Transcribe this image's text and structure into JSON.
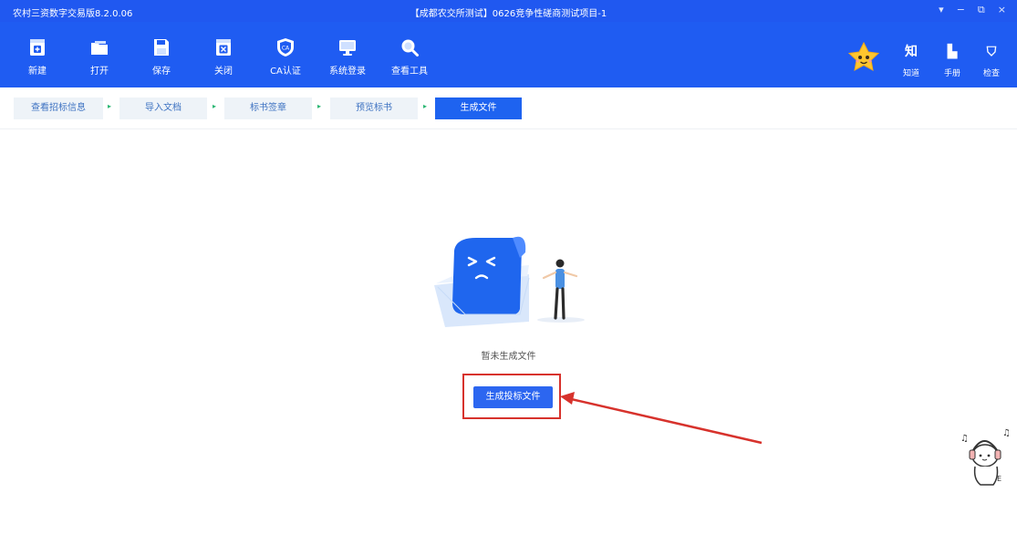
{
  "window": {
    "app_name": "农村三资数字交易版8.2.0.06",
    "title": "【成都农交所测试】0626竞争性磋商测试项目-1",
    "controls": [
      "▾",
      "−",
      "⧉",
      "×"
    ]
  },
  "toolbar": {
    "items": [
      {
        "label": "新建",
        "icon": "new-file-icon"
      },
      {
        "label": "打开",
        "icon": "open-folder-icon"
      },
      {
        "label": "保存",
        "icon": "save-icon"
      },
      {
        "label": "关闭",
        "icon": "close-file-icon"
      },
      {
        "label": "CA认证",
        "icon": "ca-shield-icon"
      },
      {
        "label": "系统登录",
        "icon": "monitor-icon"
      },
      {
        "label": "查看工具",
        "icon": "magnifier-icon"
      }
    ],
    "right_items": [
      {
        "glyph": "知",
        "label": "知道",
        "icon": "know-icon"
      },
      {
        "glyph": "▙",
        "label": "手册",
        "icon": "manual-icon"
      },
      {
        "glyph": "⛉",
        "label": "检查",
        "icon": "check-shield-icon"
      }
    ]
  },
  "steps": {
    "items": [
      "查看招标信息",
      "导入文档",
      "标书签章",
      "预览标书",
      "生成文件"
    ],
    "active_index": 4,
    "separator": "▸"
  },
  "content": {
    "empty_message": "暂未生成文件",
    "generate_button": "生成投标文件"
  },
  "colors": {
    "header": "#1f5cf2",
    "primary_button": "#2c66f0",
    "step_active": "#1e63f0",
    "step_bg": "#eef3f8",
    "annotation": "#d7322c"
  }
}
